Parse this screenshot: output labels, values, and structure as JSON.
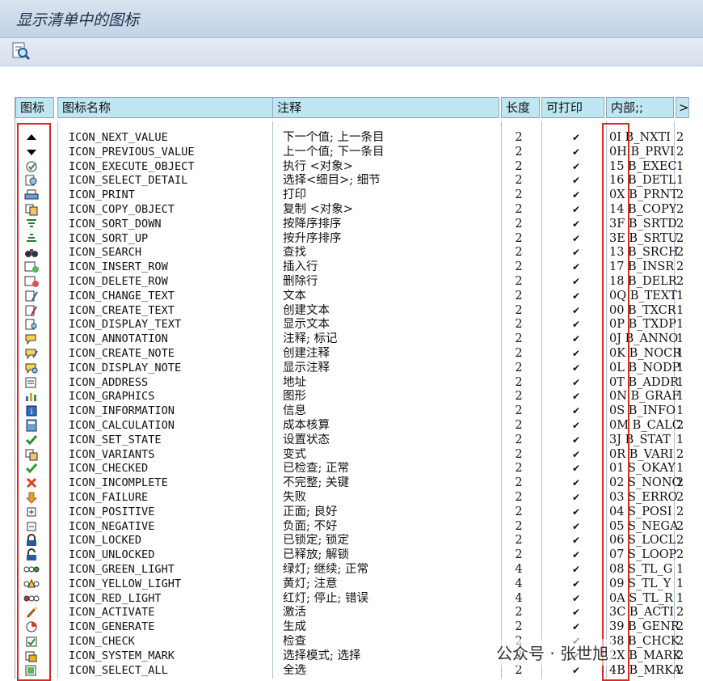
{
  "window": {
    "title": "显示清单中的图标"
  },
  "toolbar": {
    "icon": "find-icon"
  },
  "headers": {
    "icon": "图标",
    "name": "图标名称",
    "note": "注释",
    "len": "长度",
    "print": "可打印",
    "internal": "内部;;",
    "more": ">"
  },
  "watermark": "张世旭",
  "footer": "公众号 · 张世旭",
  "rows": [
    {
      "icon": "triangle-up-icon",
      "name": "ICON_NEXT_VALUE",
      "note": "下一个值; 上一条目",
      "len": "2",
      "print": "✔",
      "internal": "0I B_NXTI",
      "x": "2"
    },
    {
      "icon": "triangle-down-icon",
      "name": "ICON_PREVIOUS_VALUE",
      "note": "上一个值; 下一条目",
      "len": "2",
      "print": "✔",
      "internal": "0H B_PRVI",
      "x": "2"
    },
    {
      "icon": "execute-icon",
      "name": "ICON_EXECUTE_OBJECT",
      "note": "执行 <对象>",
      "len": "2",
      "print": "✔",
      "internal": "15 B_EXEC",
      "x": "1"
    },
    {
      "icon": "select-detail-icon",
      "name": "ICON_SELECT_DETAIL",
      "note": "选择<细目>; 细节",
      "len": "2",
      "print": "✔",
      "internal": "16 B_DETL",
      "x": "1"
    },
    {
      "icon": "print-icon",
      "name": "ICON_PRINT",
      "note": "打印",
      "len": "2",
      "print": "✔",
      "internal": "0X B_PRNT",
      "x": "2"
    },
    {
      "icon": "copy-icon",
      "name": "ICON_COPY_OBJECT",
      "note": "复制 <对象>",
      "len": "2",
      "print": "✔",
      "internal": "14 B_COPY",
      "x": "2"
    },
    {
      "icon": "sort-down-icon",
      "name": "ICON_SORT_DOWN",
      "note": "按降序排序",
      "len": "2",
      "print": "✔",
      "internal": "3F B_SRTD",
      "x": "2"
    },
    {
      "icon": "sort-up-icon",
      "name": "ICON_SORT_UP",
      "note": "按升序排序",
      "len": "2",
      "print": "✔",
      "internal": "3E B_SRTU",
      "x": "2"
    },
    {
      "icon": "binoculars-icon",
      "name": "ICON_SEARCH",
      "note": "查找",
      "len": "2",
      "print": "✔",
      "internal": "13 B_SRCH",
      "x": "2"
    },
    {
      "icon": "insert-row-icon",
      "name": "ICON_INSERT_ROW",
      "note": "插入行",
      "len": "2",
      "print": "✔",
      "internal": "17 B_INSR",
      "x": "2"
    },
    {
      "icon": "delete-row-icon",
      "name": "ICON_DELETE_ROW",
      "note": "删除行",
      "len": "2",
      "print": "✔",
      "internal": "18 B_DELR",
      "x": "2"
    },
    {
      "icon": "change-text-icon",
      "name": "ICON_CHANGE_TEXT",
      "note": "文本",
      "len": "2",
      "print": "✔",
      "internal": "0Q B_TEXT",
      "x": "1"
    },
    {
      "icon": "create-text-icon",
      "name": "ICON_CREATE_TEXT",
      "note": "创建文本",
      "len": "2",
      "print": "✔",
      "internal": "00 B_TXCR",
      "x": "1"
    },
    {
      "icon": "display-text-icon",
      "name": "ICON_DISPLAY_TEXT",
      "note": "显示文本",
      "len": "2",
      "print": "✔",
      "internal": "0P B_TXDP",
      "x": "1"
    },
    {
      "icon": "annotation-icon",
      "name": "ICON_ANNOTATION",
      "note": "注释; 标记",
      "len": "2",
      "print": "✔",
      "internal": "0J B_ANNO",
      "x": "1"
    },
    {
      "icon": "create-note-icon",
      "name": "ICON_CREATE_NOTE",
      "note": "创建注释",
      "len": "2",
      "print": "✔",
      "internal": "0K B_NOCR",
      "x": "1"
    },
    {
      "icon": "display-note-icon",
      "name": "ICON_DISPLAY_NOTE",
      "note": "显示注释",
      "len": "2",
      "print": "✔",
      "internal": "0L B_NODP",
      "x": "1"
    },
    {
      "icon": "address-icon",
      "name": "ICON_ADDRESS",
      "note": "地址",
      "len": "2",
      "print": "✔",
      "internal": "0T B_ADDR",
      "x": "1"
    },
    {
      "icon": "graphics-icon",
      "name": "ICON_GRAPHICS",
      "note": "图形",
      "len": "2",
      "print": "✔",
      "internal": "0N B_GRAF",
      "x": "1"
    },
    {
      "icon": "information-icon",
      "name": "ICON_INFORMATION",
      "note": "信息",
      "len": "2",
      "print": "✔",
      "internal": "0S B_INFO",
      "x": "1"
    },
    {
      "icon": "calculator-icon",
      "name": "ICON_CALCULATION",
      "note": "成本核算",
      "len": "2",
      "print": "✔",
      "internal": "0M B_CALC",
      "x": "2"
    },
    {
      "icon": "set-state-icon",
      "name": "ICON_SET_STATE",
      "note": "设置状态",
      "len": "2",
      "print": "✔",
      "internal": "3J B_STAT",
      "x": "1"
    },
    {
      "icon": "variants-icon",
      "name": "ICON_VARIANTS",
      "note": "变式",
      "len": "2",
      "print": "✔",
      "internal": "0R B_VARI",
      "x": "2"
    },
    {
      "icon": "checkmark-icon",
      "name": "ICON_CHECKED",
      "note": "已检查; 正常",
      "len": "2",
      "print": "✔",
      "internal": "01 S_OKAY",
      "x": "1"
    },
    {
      "icon": "cross-icon",
      "name": "ICON_INCOMPLETE",
      "note": "不完整; 关键",
      "len": "2",
      "print": "✔",
      "internal": "02 S_NONO",
      "x": "2"
    },
    {
      "icon": "failure-icon",
      "name": "ICON_FAILURE",
      "note": "失败",
      "len": "2",
      "print": "✔",
      "internal": "03 S_ERRO",
      "x": "2"
    },
    {
      "icon": "plus-icon",
      "name": "ICON_POSITIVE",
      "note": "正面; 良好",
      "len": "2",
      "print": "✔",
      "internal": "04 S_POSI",
      "x": "2"
    },
    {
      "icon": "minus-icon",
      "name": "ICON_NEGATIVE",
      "note": "负面; 不好",
      "len": "2",
      "print": "✔",
      "internal": "05 S_NEGA",
      "x": "2"
    },
    {
      "icon": "lock-icon",
      "name": "ICON_LOCKED",
      "note": "已锁定; 锁定",
      "len": "2",
      "print": "✔",
      "internal": "06 S_LOCL",
      "x": "2"
    },
    {
      "icon": "unlock-icon",
      "name": "ICON_UNLOCKED",
      "note": "已释放; 解锁",
      "len": "2",
      "print": "✔",
      "internal": "07 S_LOOP",
      "x": "2"
    },
    {
      "icon": "green-light-icon",
      "name": "ICON_GREEN_LIGHT",
      "note": "绿灯; 继续; 正常",
      "len": "4",
      "print": "✔",
      "internal": "08 S_TL_G",
      "x": "1"
    },
    {
      "icon": "yellow-light-icon",
      "name": "ICON_YELLOW_LIGHT",
      "note": "黄灯; 注意",
      "len": "4",
      "print": "✔",
      "internal": "09 S_TL_Y",
      "x": "1"
    },
    {
      "icon": "red-light-icon",
      "name": "ICON_RED_LIGHT",
      "note": "红灯; 停止; 错误",
      "len": "4",
      "print": "✔",
      "internal": "0A S_TL_R",
      "x": "1"
    },
    {
      "icon": "activate-icon",
      "name": "ICON_ACTIVATE",
      "note": "激活",
      "len": "2",
      "print": "✔",
      "internal": "3C B_ACTI",
      "x": "2"
    },
    {
      "icon": "generate-icon",
      "name": "ICON_GENERATE",
      "note": "生成",
      "len": "2",
      "print": "✔",
      "internal": "39 B_GENR",
      "x": "2"
    },
    {
      "icon": "check-icon",
      "name": "ICON_CHECK",
      "note": "检查",
      "len": "2",
      "print": "✔",
      "internal": "38 B_CHCK",
      "x": "2"
    },
    {
      "icon": "system-mark-icon",
      "name": "ICON_SYSTEM_MARK",
      "note": "选择模式; 选择",
      "len": "2",
      "print": "✔",
      "internal": "2X B_MARK",
      "x": "2"
    },
    {
      "icon": "select-all-icon",
      "name": "ICON_SELECT_ALL",
      "note": "全选",
      "len": "2",
      "print": "✔",
      "internal": "4B B_MRKA",
      "x": "2"
    }
  ]
}
